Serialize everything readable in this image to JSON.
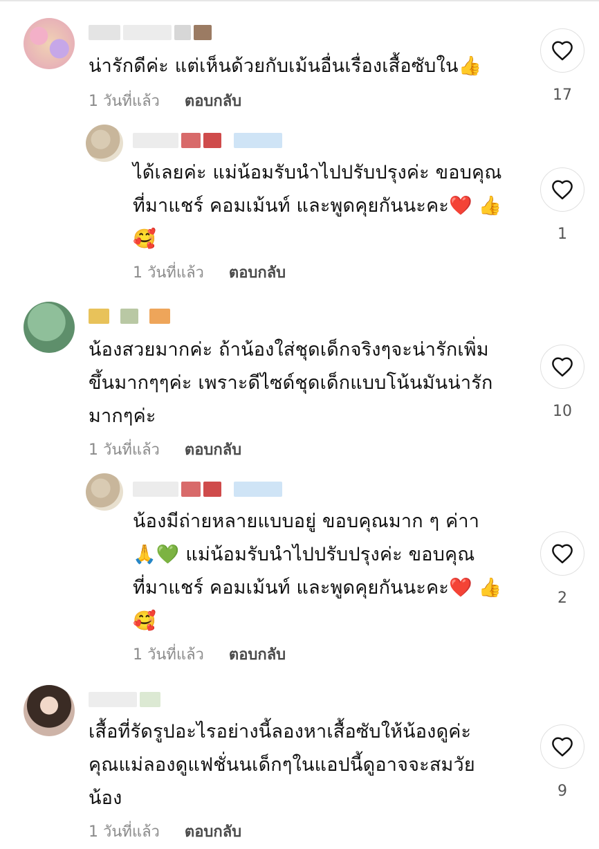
{
  "colors": {
    "text": "#111111",
    "meta": "#8a8a8a",
    "reply_button": "#4a4a4a",
    "like_count": "#555555",
    "heart_stroke": "#111111",
    "heart_button_border": "#e0e0e0"
  },
  "comments": [
    {
      "text": "น่ารักดีค่ะ แต่เห็นด้วยกับเม้นอื่นเรื่องเสื้อซับใน👍",
      "time": "1 วันที่แล้ว",
      "reply_label": "ตอบกลับ",
      "likes": "17",
      "like_icon": "heart-outline-icon"
    },
    {
      "text": "ได้เลยค่ะ แม่น้อมรับนำไปปรับปรุงค่ะ ขอบคุณ\nที่มาแชร์ คอมเม้นท์ และพูดคุยกันนะคะ❤️ 👍\n🥰",
      "time": "1 วันที่แล้ว",
      "reply_label": "ตอบกลับ",
      "likes": "1",
      "like_icon": "heart-outline-icon"
    },
    {
      "text": "น้องสวยมากค่ะ ถ้าน้องใส่ชุดเด็กจริงๆจะน่ารักเพิ่ม\nขึ้นมากๆๆค่ะ เพราะดีไซด์ชุดเด็กแบบโน้นมันน่ารัก\nมากๆค่ะ",
      "time": "1 วันที่แล้ว",
      "reply_label": "ตอบกลับ",
      "likes": "10",
      "like_icon": "heart-outline-icon"
    },
    {
      "text": "น้องมีถ่ายหลายแบบอยู่ ขอบคุณมาก ๆ ค่าา\n🙏💚 แม่น้อมรับนำไปปรับปรุงค่ะ ขอบคุณ\nที่มาแชร์ คอมเม้นท์ และพูดคุยกันนะคะ❤️ 👍\n🥰",
      "time": "1 วันที่แล้ว",
      "reply_label": "ตอบกลับ",
      "likes": "2",
      "like_icon": "heart-outline-icon"
    },
    {
      "text": "เสื้อที่รัดรูปอะไรอย่างนี้ลองหาเสื้อซับให้น้องดูค่ะ\nคุณแม่ลองดูแฟชั่นนเด็กๆในแอปนี้ดูอาจจะสมวัย\nน้อง",
      "time": "1 วันที่แล้ว",
      "reply_label": "ตอบกลับ",
      "likes": "9",
      "like_icon": "heart-outline-icon"
    }
  ]
}
